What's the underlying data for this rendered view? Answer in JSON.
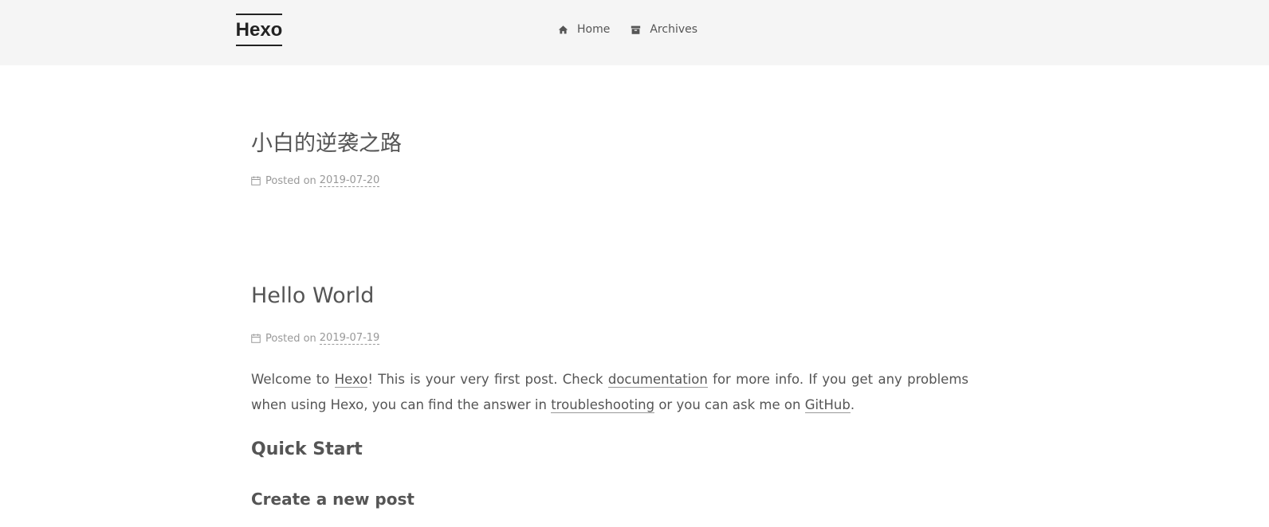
{
  "header": {
    "brand": "Hexo",
    "menu": [
      {
        "label": "Home",
        "icon": "home-icon"
      },
      {
        "label": "Archives",
        "icon": "archive-icon"
      }
    ]
  },
  "posts": [
    {
      "title": "小白的逆袭之路",
      "meta_label": "Posted on",
      "date": "2019-07-20"
    },
    {
      "title": "Hello World",
      "meta_label": "Posted on",
      "date": "2019-07-19",
      "body": {
        "t1": "Welcome to ",
        "link_hexo": "Hexo",
        "t2": "! This is your very first post. Check ",
        "link_docs": "documentation",
        "t3": " for more info. If you get any problems when using Hexo, you can find the answer in ",
        "link_trouble": "troubleshooting",
        "t4": " or you can ask me on ",
        "link_github": "GitHub",
        "t5": "."
      },
      "h2": "Quick Start",
      "h3": "Create a new post"
    }
  ],
  "colors": {
    "header_bg": "#f5f5f5",
    "text": "#555555",
    "meta": "#999999",
    "brand": "#222222"
  }
}
